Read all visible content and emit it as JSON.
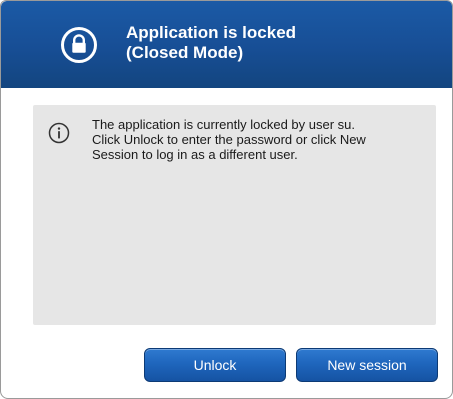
{
  "dialog": {
    "title_line1": "Application is locked",
    "title_line2": "(Closed Mode)",
    "header_icon": "lock-icon",
    "message_icon": "info-icon",
    "message_line1": "The application is currently locked by user su.",
    "message_line2": "Click Unlock to enter the password or click New",
    "message_line3": "Session to log in as a different user.",
    "buttons": {
      "unlock_label": "Unlock",
      "new_session_label": "New session"
    }
  },
  "colors": {
    "header": "#1b5aa6",
    "panel": "#e6e6e6",
    "button": "#1f66bd",
    "text": "#1a1a1a"
  }
}
